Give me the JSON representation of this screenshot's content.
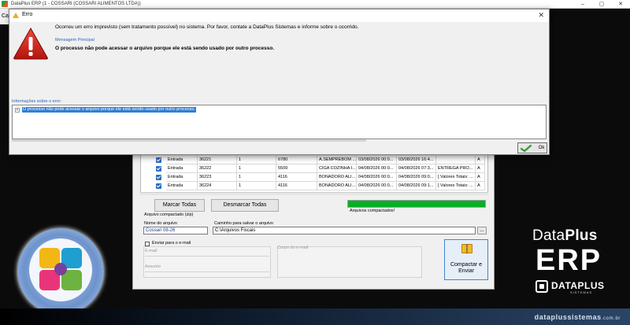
{
  "app": {
    "title": "DataPlus ERP (1 - COSSARI  (COSSARI ALIMENTOS LTDA))",
    "minimize_glyph": "–",
    "maximize_glyph": "▢",
    "close_glyph": "✕",
    "menu_stub": "Ca"
  },
  "dialog": {
    "title": "Erro",
    "close_glyph": "✕",
    "message": "Ocorreu um erro imprevisto (sem tratamento possível) no sistema. Por favor, contate a DataPlus Sistemas e informe sobre o ocorrido.",
    "main_label": "Mensagem Principal",
    "main_message": "O processo não pode acessar o arquivo porque ele está sendo usado por outro processo.",
    "info_label": "Informações sobre o erro:",
    "tree_expander": "+",
    "tree_item": "O processo não pode acessar o arquivo porque ele está sendo usado por outro processo.",
    "ok_label": "Ok",
    "warning_icon": "warning-triangle-icon",
    "ok_icon": "green-check-icon"
  },
  "grid": {
    "rows": [
      [
        "Entrada",
        "36221",
        "1",
        "6780",
        "A.SEMPREBOM ...",
        "03/08/2026 00:0...",
        "03/08/2026 16:4...",
        "",
        "A"
      ],
      [
        "Entrada",
        "36222",
        "1",
        "5509",
        "CIGA COZINHA I...",
        "04/08/2026 00:0...",
        "04/08/2026 07:3...",
        "ENTREGA PRO...",
        "A"
      ],
      [
        "Entrada",
        "36223",
        "1",
        "4116",
        "BONADORO ALI...",
        "04/08/2026 00:0...",
        "04/08/2026 09:0...",
        "[ Valores Totais: ...",
        "A"
      ],
      [
        "Entrada",
        "36224",
        "1",
        "4116",
        "BONADORO ALI...",
        "04/08/2026 00:0...",
        "04/08/2026 09:1...",
        "[ Valores Totais: ...",
        "A"
      ]
    ]
  },
  "actions": {
    "marcar": "Marcar Todas",
    "desmarcar": "Desmarcar Todas"
  },
  "progress": {
    "value": 1.0,
    "label": "Arquivos compactados!",
    "color": "#06b025"
  },
  "form": {
    "section_label": "Arquivo compactado (zip)",
    "name_label": "Nome do arquivo",
    "name_value": "Cossari 08-26",
    "path_label": "Caminho para salvar o arquivo",
    "path_value": "C:\\Arquivos Fiscais",
    "browse_label": "...",
    "send_email_label": "Enviar para o e-mail",
    "email_label": "E-mail",
    "subject_label": "Assunto",
    "body_label": "Corpo do e-mail",
    "compact_label": "Compactar e Enviar"
  },
  "brand": {
    "data": "Data",
    "plus": "Plus",
    "erp": "ERP",
    "company": "DATAPLUS",
    "company_sub": "SISTEMAS",
    "site": "dataplussistemas",
    "site_suffix": ".com.br"
  }
}
